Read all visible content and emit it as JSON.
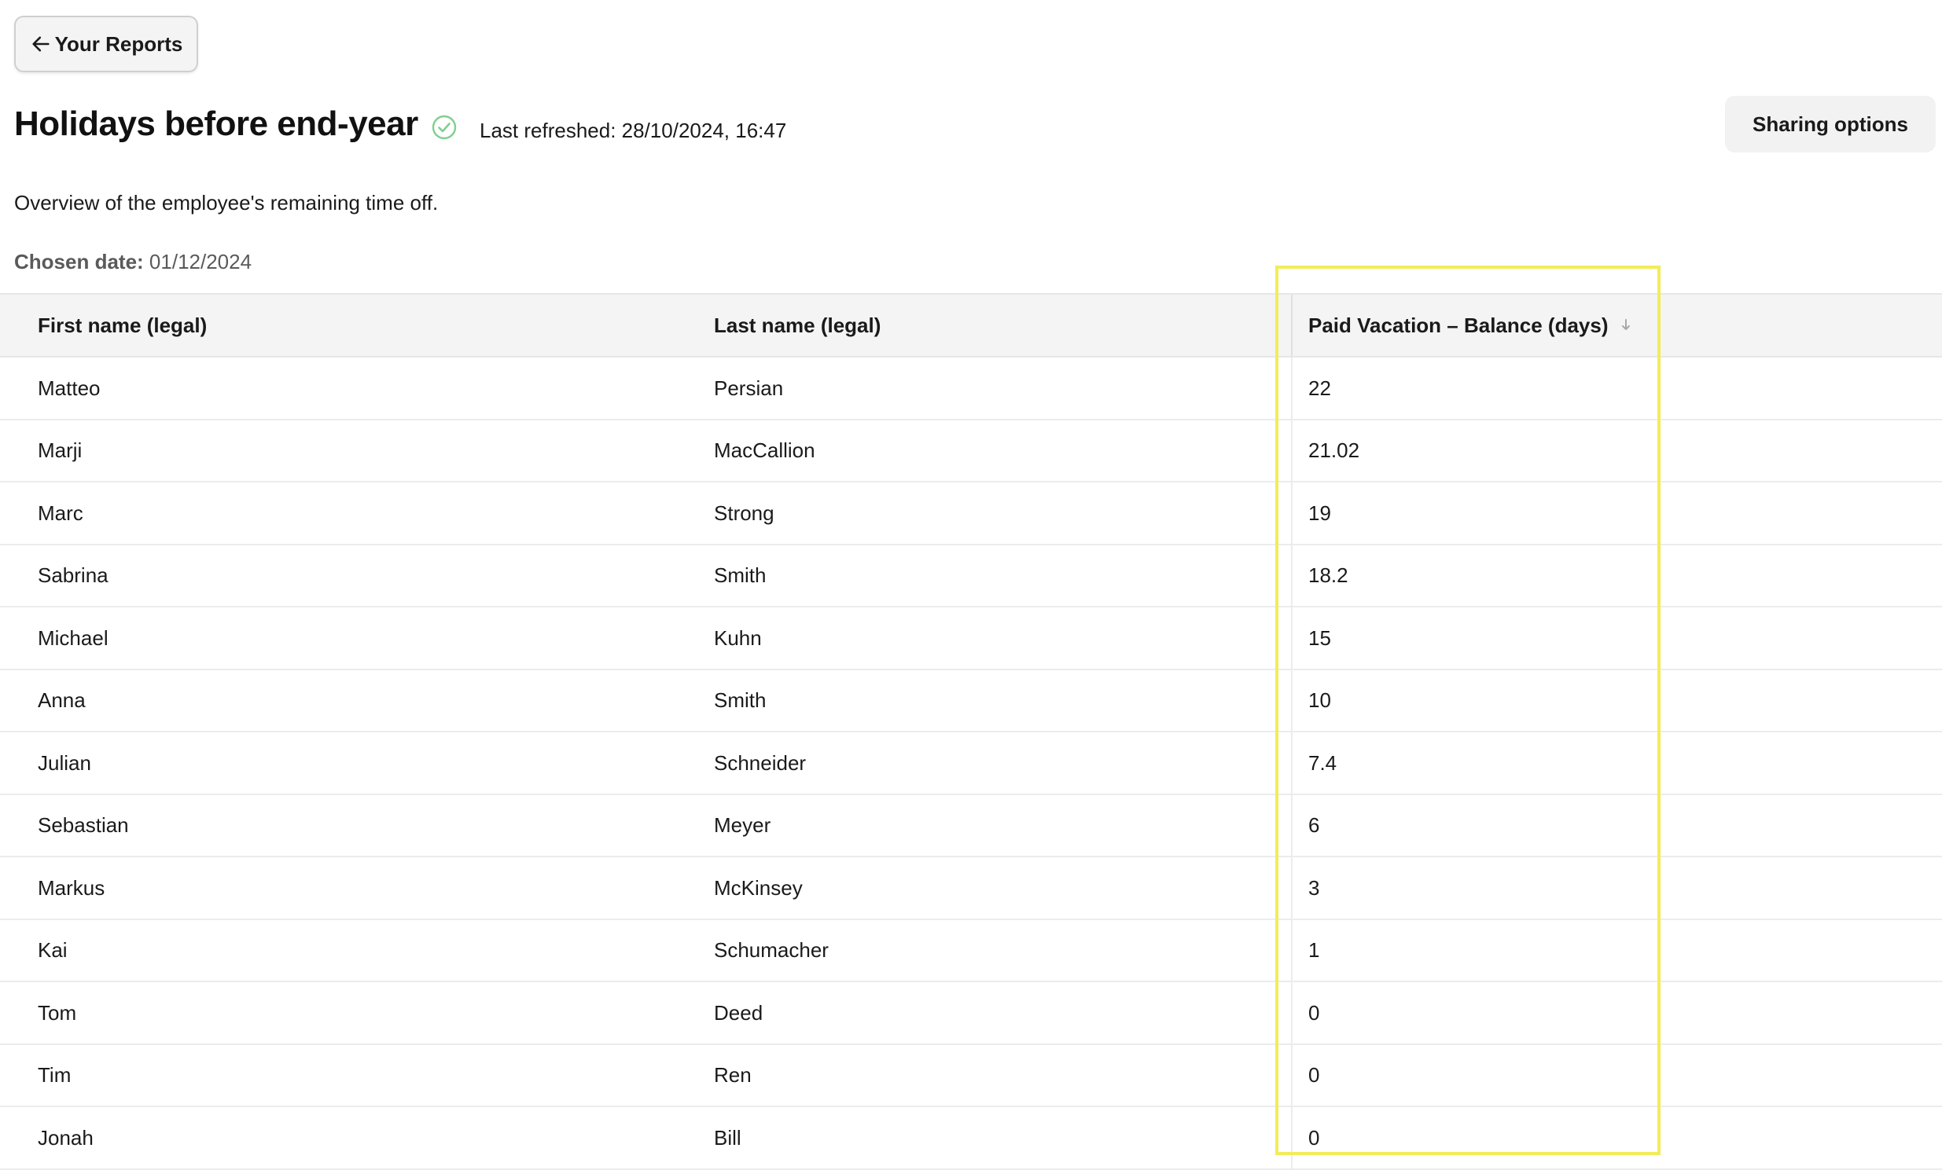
{
  "back_button": {
    "label": "Your Reports",
    "icon": "arrow-left-icon"
  },
  "header": {
    "title": "Holidays before end-year",
    "status_icon": "check-circle-icon",
    "status_color": "#4cc163",
    "last_refreshed": "Last refreshed: 28/10/2024, 16:47",
    "sharing_label": "Sharing options"
  },
  "description": "Overview of the employee's remaining time off.",
  "chosen_date": {
    "label": "Chosen date:",
    "value": "01/12/2024"
  },
  "table": {
    "columns": [
      "First name (legal)",
      "Last name (legal)",
      "Paid Vacation – Balance (days)"
    ],
    "sort_icon": "sort-down-arrow-icon",
    "rows": [
      [
        "Matteo",
        "Persian",
        "22"
      ],
      [
        "Marji",
        "MacCallion",
        "21.02"
      ],
      [
        "Marc",
        "Strong",
        "19"
      ],
      [
        "Sabrina",
        "Smith",
        "18.2"
      ],
      [
        "Michael",
        "Kuhn",
        "15"
      ],
      [
        "Anna",
        "Smith",
        "10"
      ],
      [
        "Julian",
        "Schneider",
        "7.4"
      ],
      [
        "Sebastian",
        "Meyer",
        "6"
      ],
      [
        "Markus",
        "McKinsey",
        "3"
      ],
      [
        "Kai",
        "Schumacher",
        "1"
      ],
      [
        "Tom",
        "Deed",
        "0"
      ],
      [
        "Tim",
        "Ren",
        "0"
      ],
      [
        "Jonah",
        "Bill",
        "0"
      ]
    ]
  },
  "highlight_color": "#f2ec5a"
}
